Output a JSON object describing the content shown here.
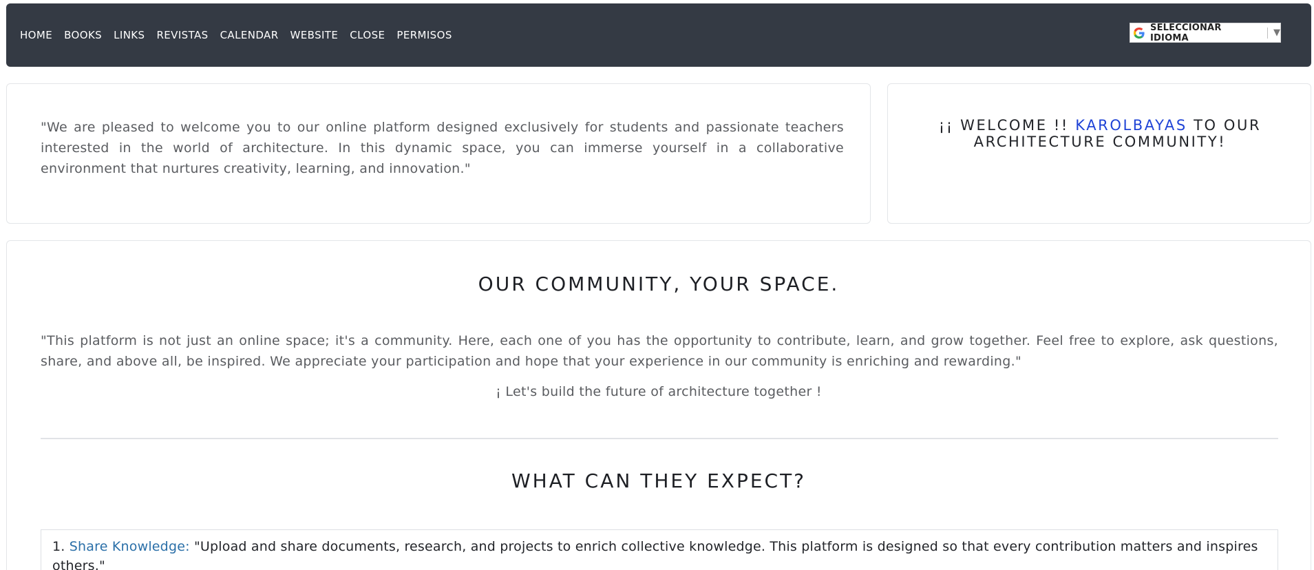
{
  "nav": {
    "links": [
      "HOME",
      "BOOKS",
      "LINKS",
      "REVISTAS",
      "CALENDAR",
      "WEBSITE",
      "CLOSE",
      "PERMISOS"
    ],
    "language_label": "SELECCIONAR IDIOMA",
    "language_caret": "▼"
  },
  "intro": {
    "text": "\"We are pleased to welcome you to our online platform designed exclusively for students and passionate teachers interested in the world of architecture. In this dynamic space, you can immerse yourself in a collaborative environment that nurtures creativity, learning, and innovation.\""
  },
  "welcome": {
    "prefix": "¡¡ WELCOME !!",
    "username": "KAROLBAYAS",
    "suffix": "TO OUR ARCHITECTURE COMMUNITY!"
  },
  "community": {
    "heading": "OUR COMMUNITY, YOUR SPACE.",
    "text": "\"This platform is not just an online space; it's a community. Here, each one of you has the opportunity to contribute, learn, and grow together. Feel free to explore, ask questions, share, and above all, be inspired. We appreciate your participation and hope that your experience in our community is enriching and rewarding.\"",
    "cta": "¡ Let's build the future of architecture together !"
  },
  "expect": {
    "heading": "WHAT CAN THEY EXPECT?",
    "items": [
      {
        "number": "1.",
        "title": "Share Knowledge:",
        "text": "\"Upload and share documents, research, and projects to enrich collective knowledge. This platform is designed so that every contribution matters and inspires others.\""
      }
    ]
  },
  "colors": {
    "navbar": "#343a44",
    "accent_user": "#1f43d6",
    "link_title": "#2a6fa8"
  }
}
